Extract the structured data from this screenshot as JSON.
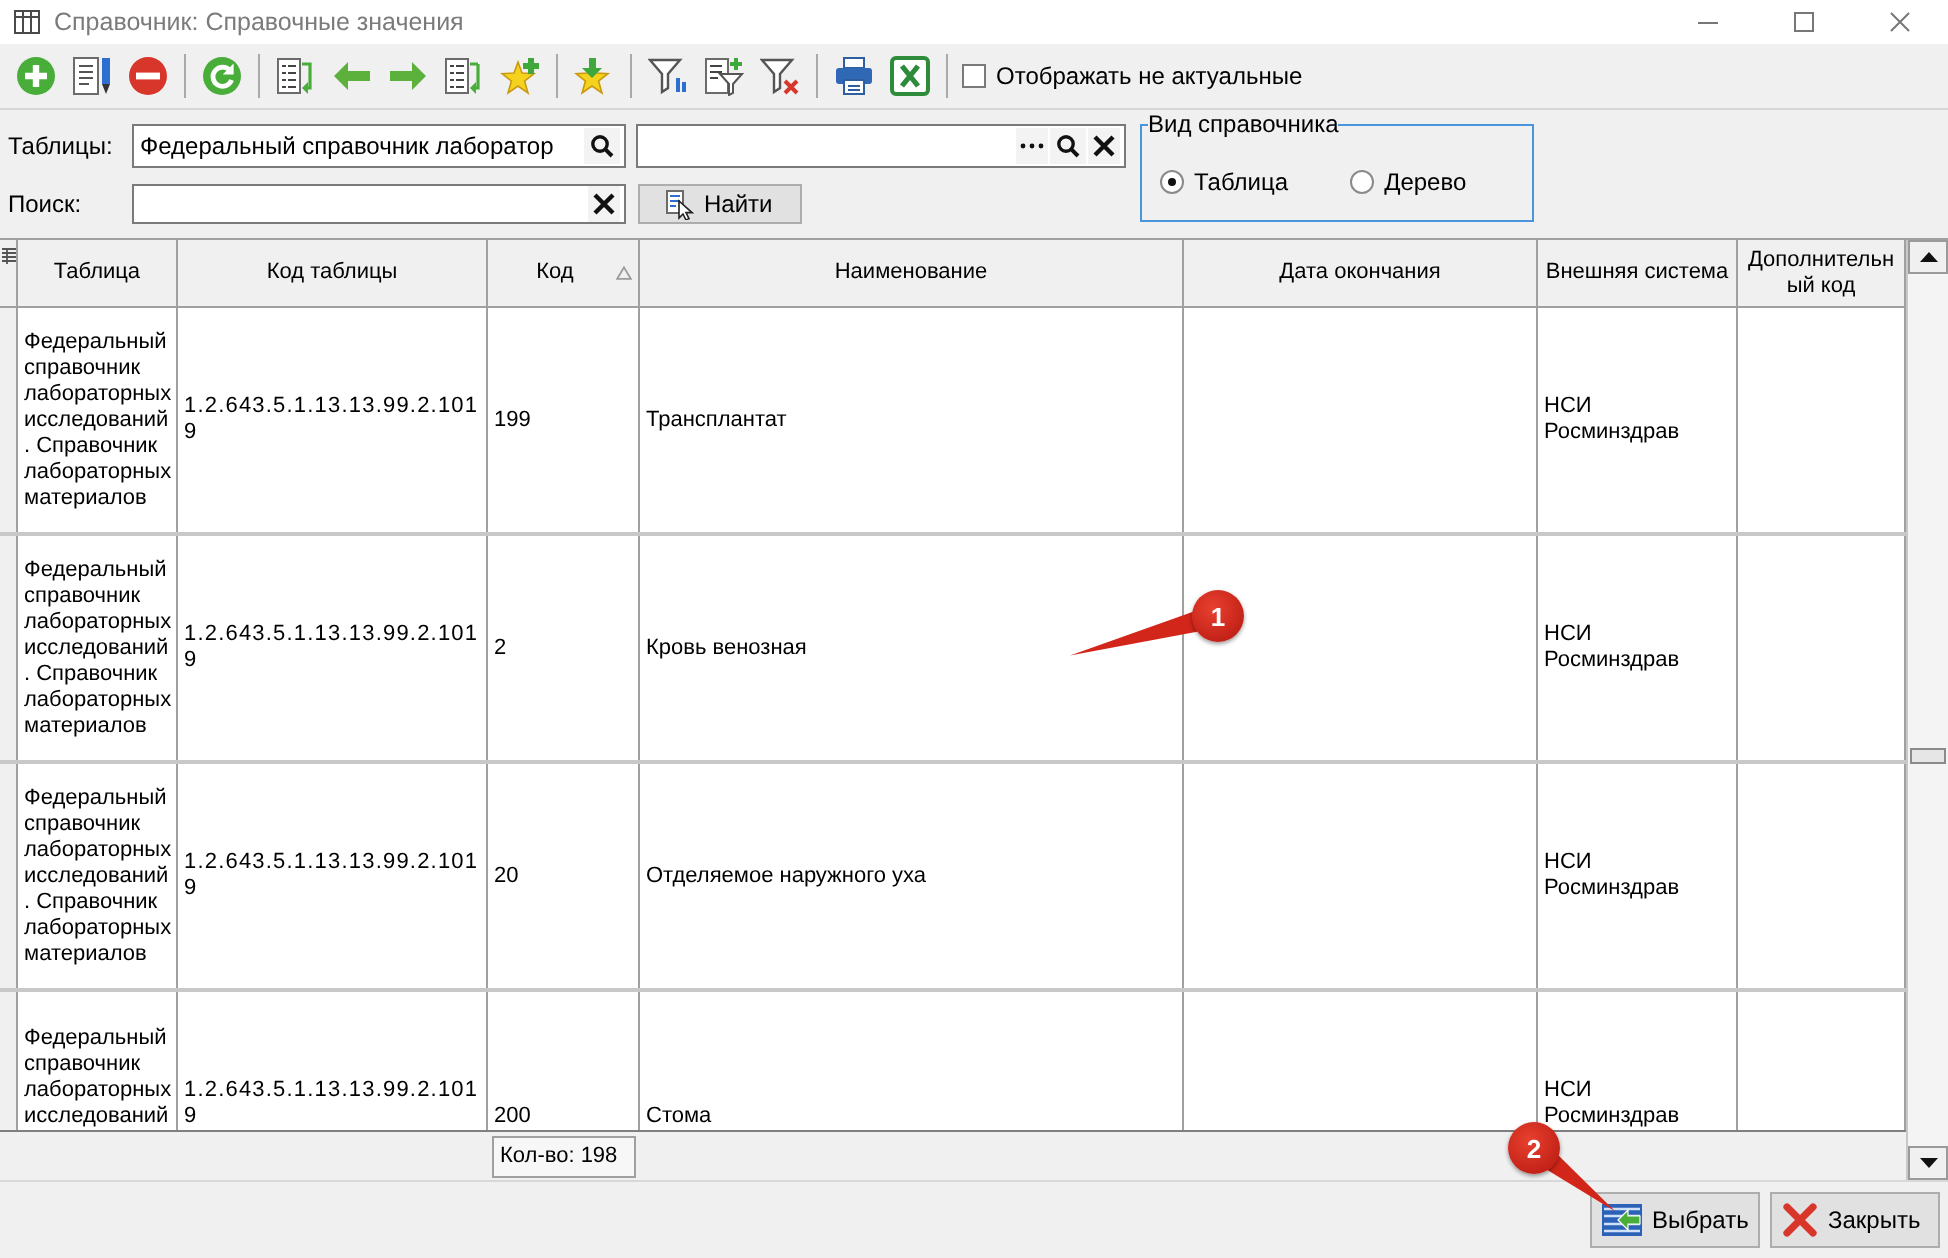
{
  "window": {
    "title": "Справочник: Справочные значения"
  },
  "toolbar": {
    "show_inactive": {
      "label": "Отображать не актуальные",
      "checked": false
    }
  },
  "filters": {
    "tables": {
      "label": "Таблицы:",
      "value": "Федеральный справочник лаборатор"
    },
    "search": {
      "label": "Поиск:"
    },
    "find_button": "Найти"
  },
  "view_group": {
    "title": "Вид справочника",
    "options": [
      {
        "label": "Таблица",
        "selected": true
      },
      {
        "label": "Дерево",
        "selected": false
      }
    ]
  },
  "table": {
    "columns": [
      {
        "label": "Таблица",
        "sorted": false
      },
      {
        "label": "Код таблицы",
        "sorted": false
      },
      {
        "label": "Код",
        "sorted": true,
        "summary": "Кол-во: 198"
      },
      {
        "label": "Наименование",
        "sorted": false
      },
      {
        "label": "Дата окончания",
        "sorted": false
      },
      {
        "label": "Внешняя система",
        "sorted": false
      },
      {
        "label": "Дополнительный код",
        "sorted": false
      }
    ],
    "rows": [
      {
        "table": "Федеральный справочник лабораторных исследований. Справочник лабораторных материалов",
        "table_code": "1.2.643.5.1.13.13.99.2.1019",
        "code": "199",
        "name": "Трансплантат",
        "external_system": "НСИ Росминздрав"
      },
      {
        "table": "Федеральный справочник лабораторных исследований. Справочник лабораторных материалов",
        "table_code": "1.2.643.5.1.13.13.99.2.1019",
        "code": "2",
        "name": "Кровь венозная",
        "external_system": "НСИ Росминздрав"
      },
      {
        "table": "Федеральный справочник лабораторных исследований. Справочник лабораторных материалов",
        "table_code": "1.2.643.5.1.13.13.99.2.1019",
        "code": "20",
        "name": "Отделяемое наружного уха",
        "external_system": "НСИ Росминздрав"
      },
      {
        "table": "Федеральный справочник лабораторных исследований",
        "table_code": "1.2.643.5.1.13.13.99.2.1019",
        "code": "200",
        "name": "Стома",
        "external_system": "НСИ Росминздрав"
      }
    ]
  },
  "buttons": [
    {
      "kind": "select",
      "label": "Выбрать"
    },
    {
      "kind": "close",
      "label": "Закрыть"
    }
  ],
  "callouts": [
    {
      "number": "1"
    },
    {
      "number": "2"
    }
  ]
}
